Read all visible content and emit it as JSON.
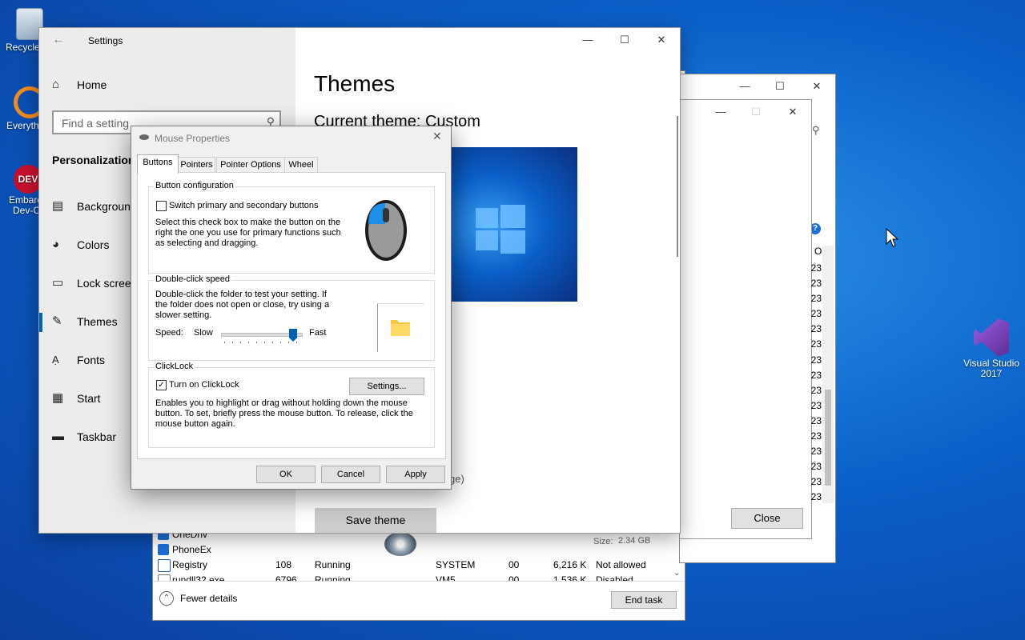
{
  "desktop": {
    "icons": [
      {
        "label": "Recycle"
      },
      {
        "label": "Everyth"
      },
      {
        "label": "Embarca\nDev-C-"
      },
      {
        "label": "Visual Studio\n2017"
      }
    ]
  },
  "task_manager": {
    "rows": [
      {
        "name": "OneDriv",
        "pid": "",
        "status": "",
        "user": "",
        "cpu": "",
        "mem": "",
        "uac": ""
      },
      {
        "name": "PhoneEx",
        "pid": "",
        "status": "",
        "user": "",
        "cpu": "",
        "mem": "",
        "uac": ""
      },
      {
        "name": "Registry",
        "pid": "108",
        "status": "Running",
        "user": "SYSTEM",
        "cpu": "00",
        "mem": "6,216 K",
        "uac": "Not allowed"
      },
      {
        "name": "rundll32.exe",
        "pid": "6796",
        "status": "Running",
        "user": "VM5",
        "cpu": "00",
        "mem": "1,536 K",
        "uac": "Disabled"
      }
    ],
    "fewer_details": "Fewer details",
    "end_task": "End task"
  },
  "properties_window": {
    "size_label": "Size:",
    "size_value": "2.34 GB",
    "close_button": "Close",
    "numbers": [
      "23",
      "23",
      "23",
      "23",
      "23",
      "23",
      "23",
      "23",
      "23",
      "23",
      "23",
      "23",
      "23",
      "23",
      "23",
      "23"
    ],
    "col_header": "O"
  },
  "settings": {
    "title": "Settings",
    "home": "Home",
    "search_placeholder": "Find a setting",
    "section": "Personalization",
    "nav": [
      {
        "label": "Background",
        "icon": "image-icon"
      },
      {
        "label": "Colors",
        "icon": "palette-icon"
      },
      {
        "label": "Lock screen",
        "icon": "lock-screen-icon"
      },
      {
        "label": "Themes",
        "icon": "themes-icon"
      },
      {
        "label": "Fonts",
        "icon": "fonts-icon"
      },
      {
        "label": "Start",
        "icon": "start-icon"
      },
      {
        "label": "Taskbar",
        "icon": "taskbar-icon"
      }
    ],
    "page_title": "Themes",
    "current_theme": "Current theme: Custom",
    "partial_text": "ge)",
    "save_theme": "Save theme",
    "accent": "#0063b1"
  },
  "mouse_properties": {
    "title": "Mouse Properties",
    "tabs": [
      "Buttons",
      "Pointers",
      "Pointer Options",
      "Wheel"
    ],
    "button_config": {
      "title": "Button configuration",
      "switch_label": "Switch primary and secondary buttons",
      "switch_checked": false,
      "description": "Select this check box to make the button on the right the one you use for primary functions such as selecting and dragging."
    },
    "double_click": {
      "title": "Double-click speed",
      "description": "Double-click the folder to test your setting. If the folder does not open or close, try using a slower setting.",
      "speed_label": "Speed:",
      "slow": "Slow",
      "fast": "Fast",
      "slider_level": 0.9
    },
    "clicklock": {
      "title": "ClickLock",
      "label": "Turn on ClickLock",
      "checked": true,
      "settings_button": "Settings...",
      "description": "Enables you to highlight or drag without holding down the mouse button. To set, briefly press the mouse button. To release, click the mouse button again."
    },
    "ok": "OK",
    "cancel": "Cancel",
    "apply": "Apply"
  }
}
